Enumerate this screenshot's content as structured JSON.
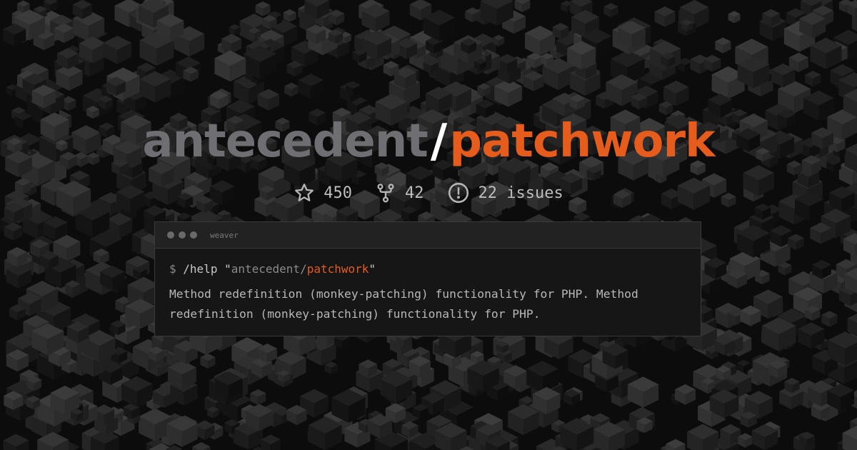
{
  "repo": {
    "owner": "antecedent",
    "slash": "/",
    "name": "patchwork"
  },
  "stats": {
    "stars": "450",
    "forks": "42",
    "issues": "22 issues",
    "star_icon": "star-icon",
    "fork_icon": "fork-icon",
    "issue_icon": "issue-icon"
  },
  "terminal": {
    "title": "weaver",
    "prompt": "$",
    "command": "/help",
    "quote_open": "\"",
    "arg_owner": "antecedent",
    "arg_slash": "/",
    "arg_repo": "patchwork",
    "quote_close": "\"",
    "description": "Method redefinition (monkey-patching) functionality for PHP. Method redefinition (monkey-patching) functionality for PHP."
  },
  "colors": {
    "background": "#0c0c0c",
    "owner": "#6e6e73",
    "slash": "#ffffff",
    "accent": "#e65c1c",
    "stat_text": "#bdbdbd"
  }
}
